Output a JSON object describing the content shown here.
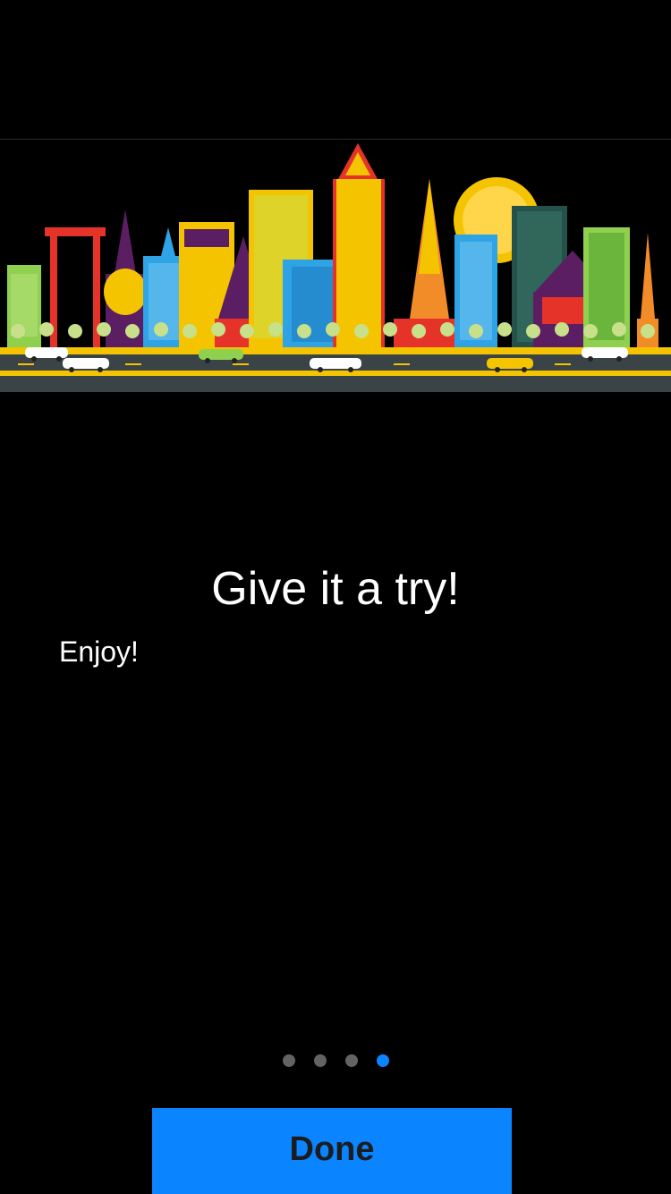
{
  "onboarding": {
    "title": "Give it a try!",
    "subtitle": "Enjoy!",
    "pager": {
      "page_count": 4,
      "current_page": 4,
      "active_color": "#0a84ff",
      "inactive_color": "#636366"
    },
    "done_label": "Done"
  },
  "hero_image": {
    "subject": "illustrated city skyline with temples, towers, sun and cars on a road",
    "colors": [
      "#f5c400",
      "#e6332a",
      "#5b1e62",
      "#2ea3e6",
      "#8fd14f",
      "#f28c28"
    ]
  },
  "colors": {
    "background": "#000000",
    "accent": "#0a84ff",
    "button_text": "#1c1c1e",
    "text": "#ffffff"
  }
}
